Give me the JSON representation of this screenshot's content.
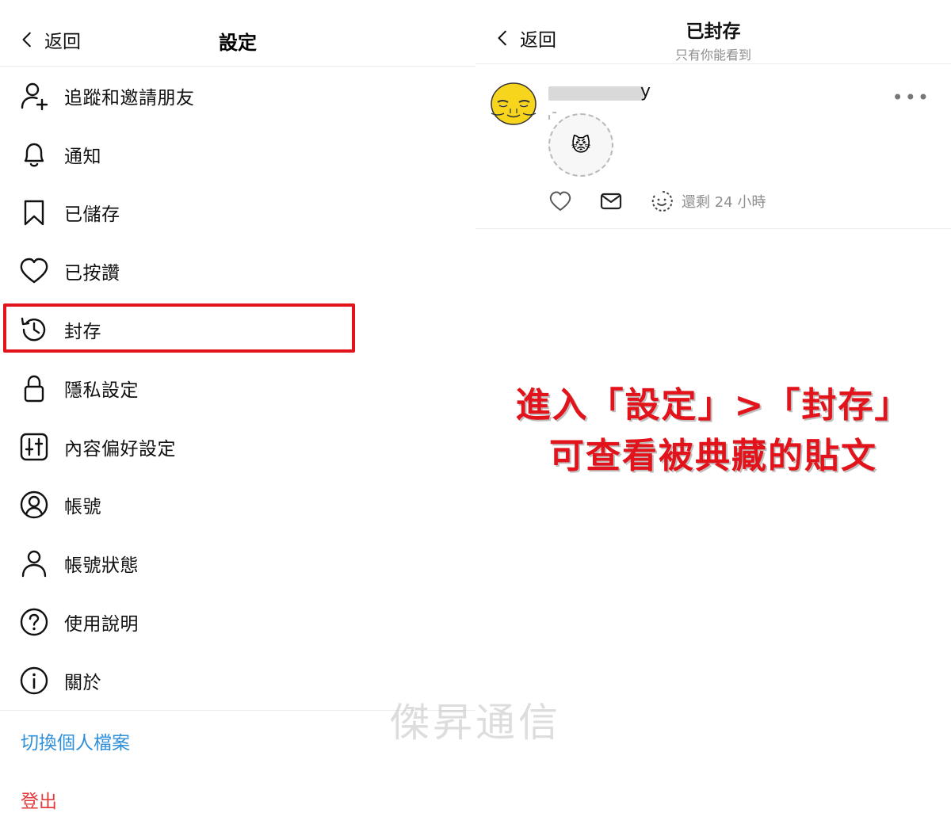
{
  "settings": {
    "back_label": "返回",
    "title": "設定",
    "items": [
      {
        "label": "追蹤和邀請朋友",
        "icon": "add-user-icon"
      },
      {
        "label": "通知",
        "icon": "bell-icon"
      },
      {
        "label": "已儲存",
        "icon": "bookmark-icon"
      },
      {
        "label": "已按讚",
        "icon": "heart-icon"
      },
      {
        "label": "封存",
        "icon": "archive-history-icon"
      },
      {
        "label": "隱私設定",
        "icon": "lock-icon"
      },
      {
        "label": "內容偏好設定",
        "icon": "sliders-icon"
      },
      {
        "label": "帳號",
        "icon": "account-circle-icon"
      },
      {
        "label": "帳號狀態",
        "icon": "person-icon"
      },
      {
        "label": "使用說明",
        "icon": "help-icon"
      },
      {
        "label": "關於",
        "icon": "info-icon"
      }
    ],
    "switch_profile": "切換個人檔案",
    "logout": "登出"
  },
  "archive": {
    "back_label": "返回",
    "title": "已封存",
    "subtitle": "只有你能看到",
    "post": {
      "username_visible": "y",
      "emoji": "😾",
      "remaining": "還剩 24 小時"
    }
  },
  "annotation": {
    "line1": "進入「設定」>「封存」",
    "line2": "可查看被典藏的貼文"
  },
  "watermark": "傑昇通信",
  "colors": {
    "highlight": "#e2131b",
    "link_blue": "#2f8fd8",
    "logout_red": "#e23b3b",
    "annotation_red": "#e2131b"
  }
}
